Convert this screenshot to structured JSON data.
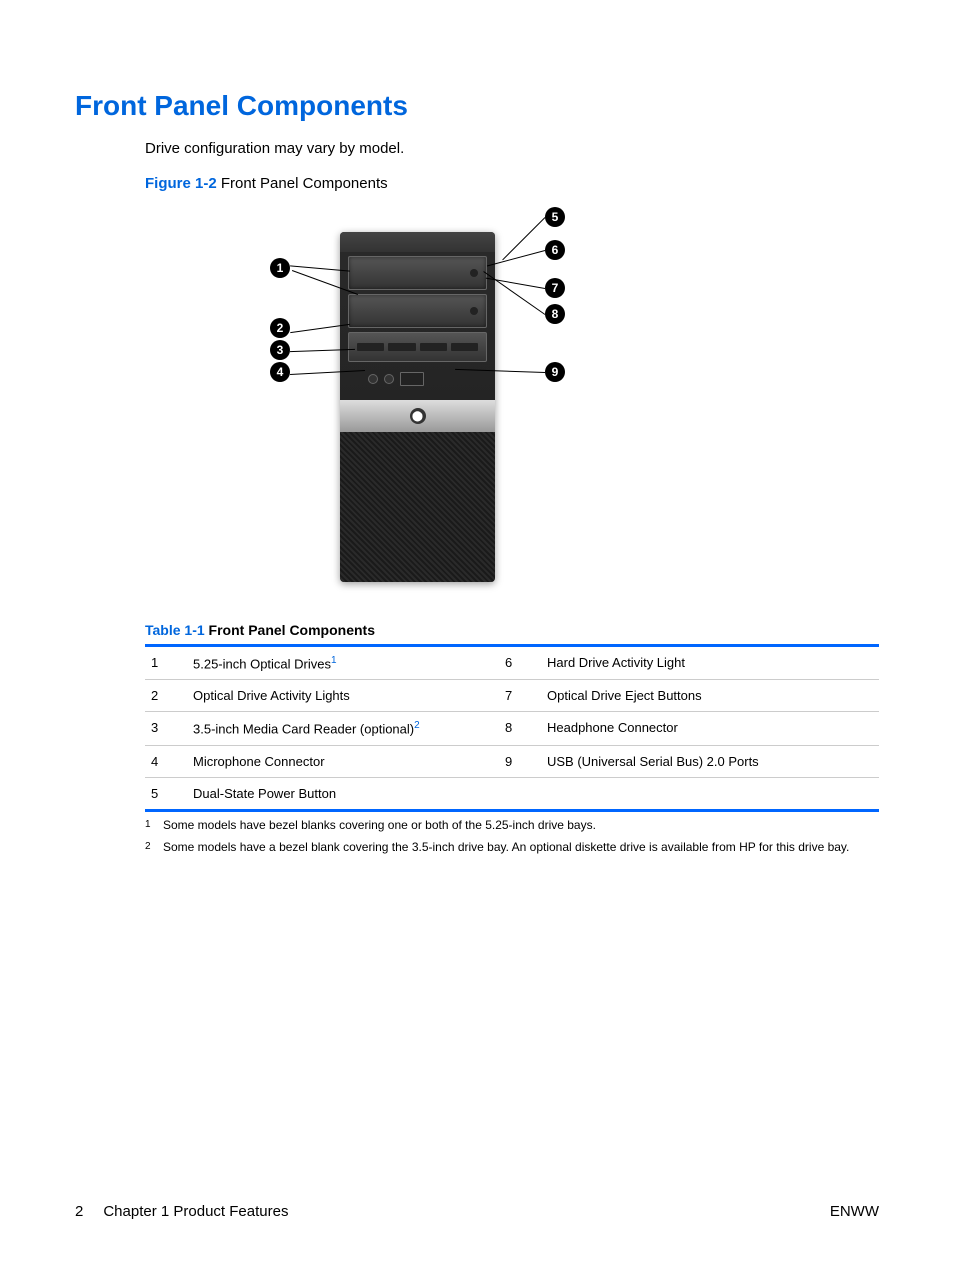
{
  "heading": "Front Panel Components",
  "intro": "Drive configuration may vary by model.",
  "figure": {
    "label": "Figure 1-2",
    "title": "Front Panel Components"
  },
  "callouts": {
    "left": [
      "1",
      "2",
      "3",
      "4"
    ],
    "right": [
      "5",
      "6",
      "7",
      "8",
      "9"
    ]
  },
  "table": {
    "label": "Table 1-1",
    "title": "Front Panel Components",
    "rows": [
      {
        "n1": "1",
        "d1": "5.25-inch Optical Drives",
        "s1": "1",
        "n2": "6",
        "d2": "Hard Drive Activity Light"
      },
      {
        "n1": "2",
        "d1": "Optical Drive Activity Lights",
        "s1": "",
        "n2": "7",
        "d2": "Optical Drive Eject Buttons"
      },
      {
        "n1": "3",
        "d1": "3.5-inch Media Card Reader (optional)",
        "s1": "2",
        "n2": "8",
        "d2": "Headphone Connector"
      },
      {
        "n1": "4",
        "d1": "Microphone Connector",
        "s1": "",
        "n2": "9",
        "d2": "USB (Universal Serial Bus) 2.0 Ports"
      },
      {
        "n1": "5",
        "d1": "Dual-State Power Button",
        "s1": "",
        "n2": "",
        "d2": ""
      }
    ]
  },
  "footnotes": [
    {
      "num": "1",
      "text": "Some models have bezel blanks covering one or both of the 5.25-inch drive bays."
    },
    {
      "num": "2",
      "text": "Some models have a bezel blank covering the 3.5-inch drive bay. An optional diskette drive is available from HP for this drive bay."
    }
  ],
  "footer": {
    "page": "2",
    "chapter": "Chapter 1   Product Features",
    "right": "ENWW"
  }
}
